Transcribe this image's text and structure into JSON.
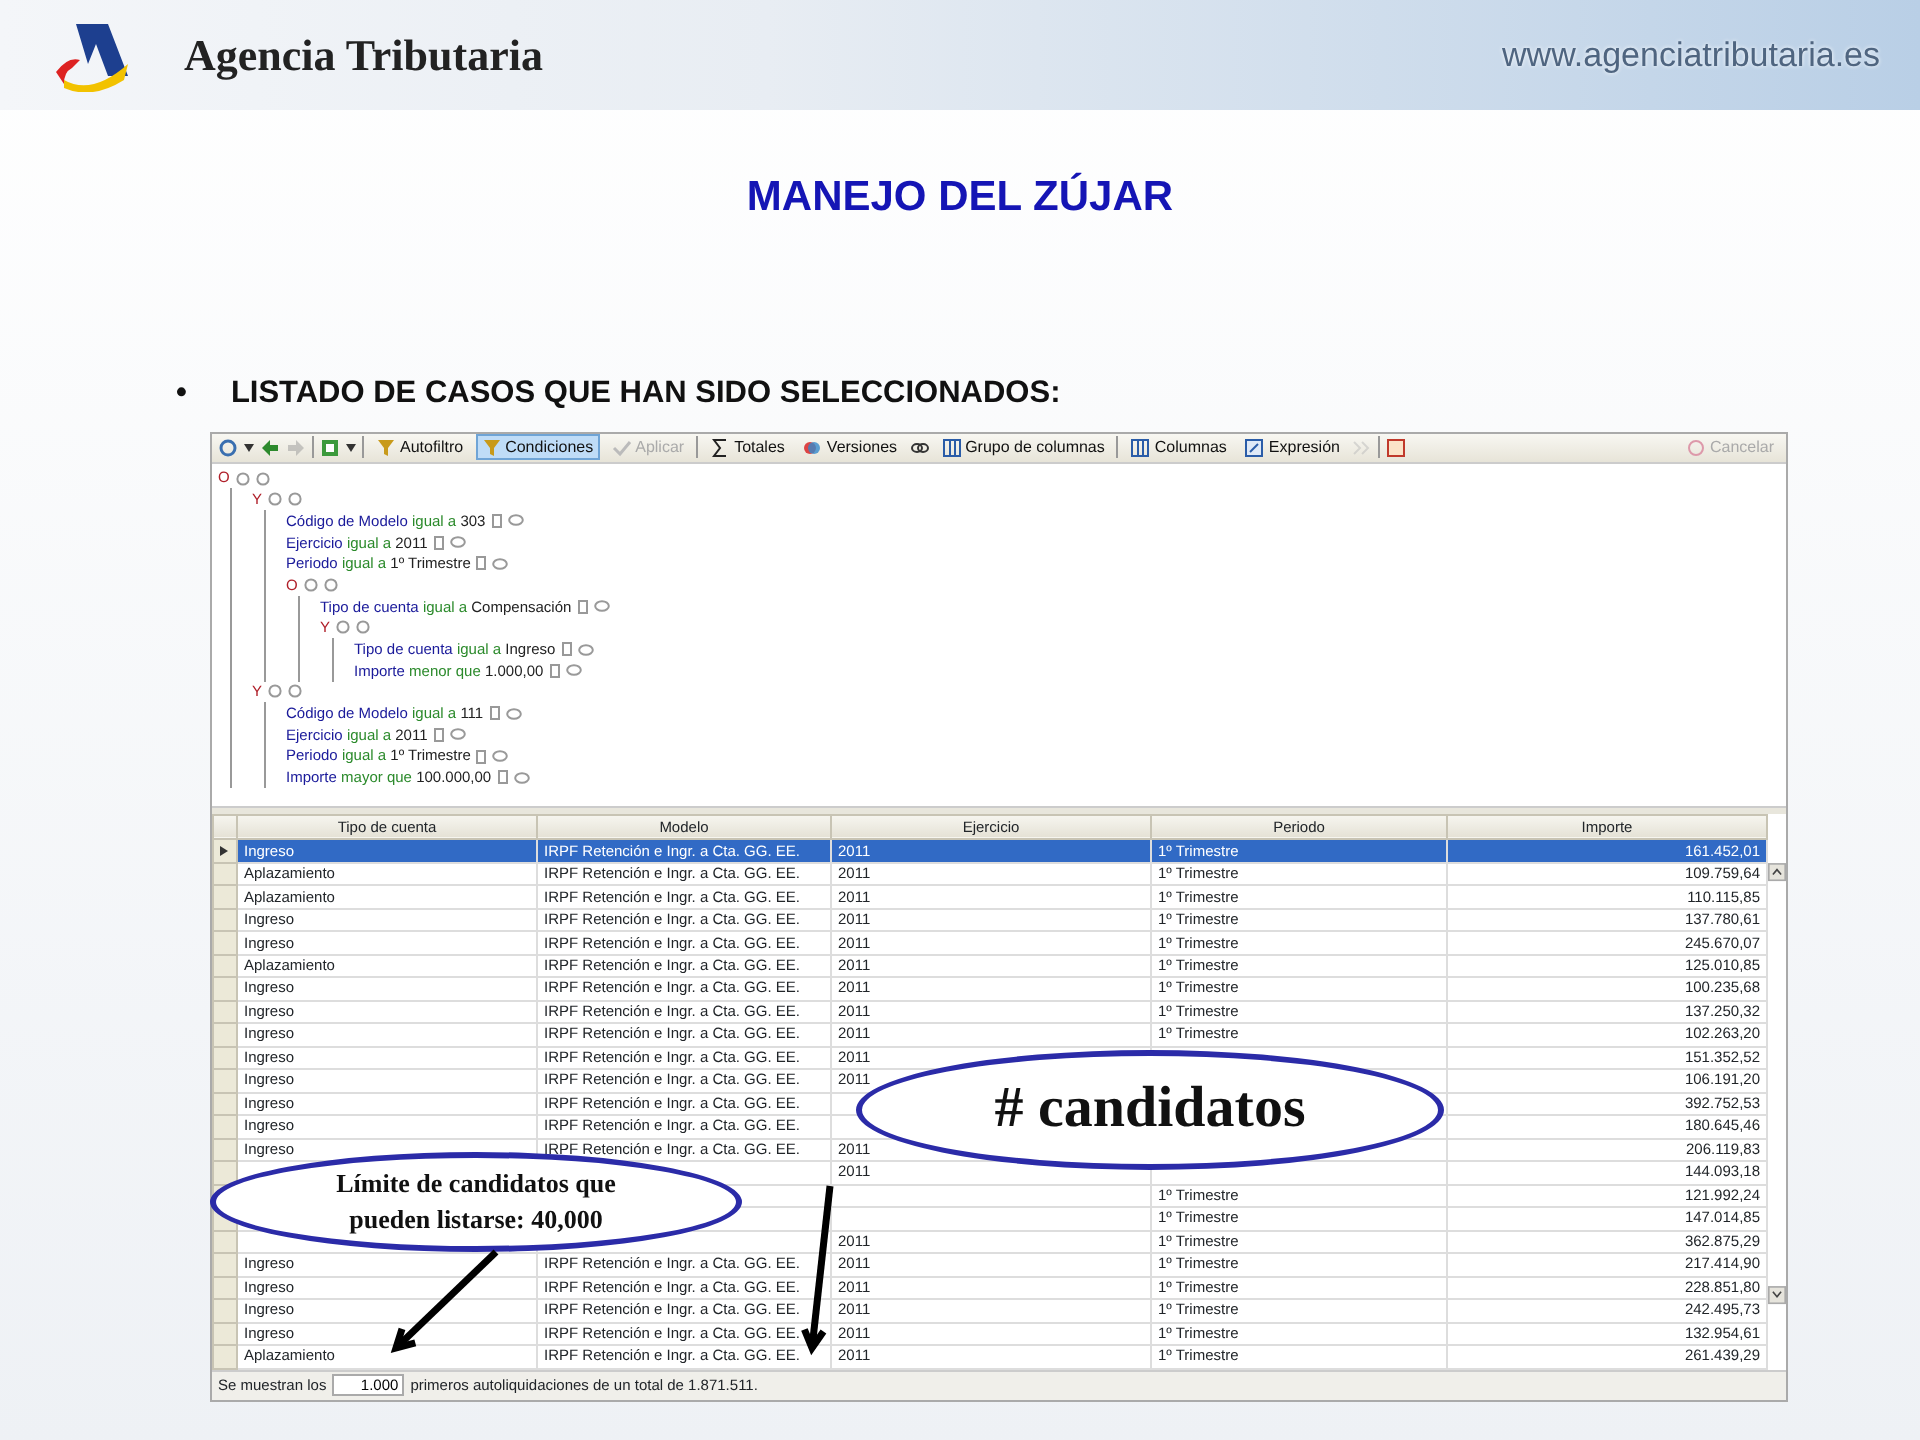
{
  "header": {
    "brand": "Agencia Tributaria",
    "website": "www.agenciatributaria.es"
  },
  "title": "MANEJO DEL ZÚJAR",
  "bullet": {
    "mark": "•",
    "text": "LISTADO DE CASOS QUE HAN SIDO SELECCIONADOS:"
  },
  "toolbar": [
    {
      "kind": "icon",
      "disabled": false
    },
    {
      "kind": "caret",
      "disabled": false
    },
    {
      "kind": "icon",
      "disabled": false
    },
    {
      "kind": "icon",
      "disabled": true
    },
    {
      "kind": "sep"
    },
    {
      "kind": "icon",
      "disabled": false
    },
    {
      "kind": "caret",
      "disabled": false
    },
    {
      "kind": "sep"
    },
    {
      "kind": "button",
      "label": "Autofiltro",
      "selected": false,
      "disabled": false
    },
    {
      "kind": "button",
      "label": "Condiciones",
      "selected": true,
      "disabled": false
    },
    {
      "kind": "button",
      "label": "Aplicar",
      "selected": false,
      "disabled": true
    },
    {
      "kind": "sep"
    },
    {
      "kind": "button",
      "label": "Totales",
      "selected": false,
      "disabled": false
    },
    {
      "kind": "button",
      "label": "Versiones",
      "selected": false,
      "disabled": false
    },
    {
      "kind": "icon",
      "disabled": false
    },
    {
      "kind": "button",
      "label": "Grupo de columnas",
      "selected": false,
      "disabled": false
    },
    {
      "kind": "sep"
    },
    {
      "kind": "button",
      "label": "Columnas",
      "selected": false,
      "disabled": false
    },
    {
      "kind": "button",
      "label": "Expresión",
      "selected": false,
      "disabled": false
    },
    {
      "kind": "icon",
      "disabled": true
    },
    {
      "kind": "sep"
    },
    {
      "kind": "icon",
      "disabled": false
    },
    {
      "kind": "spacer"
    },
    {
      "kind": "button",
      "label": "Cancelar",
      "selected": false,
      "disabled": true
    }
  ],
  "tree": {
    "kind": "group",
    "operator": "O",
    "children": [
      {
        "kind": "group",
        "operator": "Y",
        "children": [
          {
            "kind": "condition",
            "field": "Código de Modelo",
            "op": "igual a",
            "value": "303"
          },
          {
            "kind": "condition",
            "field": "Ejercicio",
            "op": "igual a",
            "value": "2011"
          },
          {
            "kind": "condition",
            "field": "Periodo",
            "op": "igual a",
            "value": "1º Trimestre"
          },
          {
            "kind": "group",
            "operator": "O",
            "children": [
              {
                "kind": "condition",
                "field": "Tipo de cuenta",
                "op": "igual a",
                "value": "Compensación"
              },
              {
                "kind": "group",
                "operator": "Y",
                "children": [
                  {
                    "kind": "condition",
                    "field": "Tipo de cuenta",
                    "op": "igual a",
                    "value": "Ingreso"
                  },
                  {
                    "kind": "condition",
                    "field": "Importe",
                    "op": "menor que",
                    "value": "1.000,00"
                  }
                ]
              }
            ]
          }
        ]
      },
      {
        "kind": "group",
        "operator": "Y",
        "children": [
          {
            "kind": "condition",
            "field": "Código de Modelo",
            "op": "igual a",
            "value": "111"
          },
          {
            "kind": "condition",
            "field": "Ejercicio",
            "op": "igual a",
            "value": "2011"
          },
          {
            "kind": "condition",
            "field": "Periodo",
            "op": "igual a",
            "value": "1º Trimestre"
          },
          {
            "kind": "condition",
            "field": "Importe",
            "op": "mayor que",
            "value": "100.000,00"
          }
        ]
      }
    ]
  },
  "table": {
    "columns": [
      "Tipo de cuenta",
      "Modelo",
      "Ejercicio",
      "Periodo",
      "Importe"
    ],
    "rows": [
      {
        "selected": true,
        "cells": [
          "Ingreso",
          "IRPF Retención e Ingr. a Cta. GG. EE.",
          "2011",
          "1º Trimestre",
          "161.452,01"
        ]
      },
      {
        "selected": false,
        "cells": [
          "Aplazamiento",
          "IRPF Retención e Ingr. a Cta. GG. EE.",
          "2011",
          "1º Trimestre",
          "109.759,64"
        ]
      },
      {
        "selected": false,
        "cells": [
          "Aplazamiento",
          "IRPF Retención e Ingr. a Cta. GG. EE.",
          "2011",
          "1º Trimestre",
          "110.115,85"
        ]
      },
      {
        "selected": false,
        "cells": [
          "Ingreso",
          "IRPF Retención e Ingr. a Cta. GG. EE.",
          "2011",
          "1º Trimestre",
          "137.780,61"
        ]
      },
      {
        "selected": false,
        "cells": [
          "Ingreso",
          "IRPF Retención e Ingr. a Cta. GG. EE.",
          "2011",
          "1º Trimestre",
          "245.670,07"
        ]
      },
      {
        "selected": false,
        "cells": [
          "Aplazamiento",
          "IRPF Retención e Ingr. a Cta. GG. EE.",
          "2011",
          "1º Trimestre",
          "125.010,85"
        ]
      },
      {
        "selected": false,
        "cells": [
          "Ingreso",
          "IRPF Retención e Ingr. a Cta. GG. EE.",
          "2011",
          "1º Trimestre",
          "100.235,68"
        ]
      },
      {
        "selected": false,
        "cells": [
          "Ingreso",
          "IRPF Retención e Ingr. a Cta. GG. EE.",
          "2011",
          "1º Trimestre",
          "137.250,32"
        ]
      },
      {
        "selected": false,
        "cells": [
          "Ingreso",
          "IRPF Retención e Ingr. a Cta. GG. EE.",
          "2011",
          "1º Trimestre",
          "102.263,20"
        ]
      },
      {
        "selected": false,
        "cells": [
          "Ingreso",
          "IRPF Retención e Ingr. a Cta. GG. EE.",
          "2011",
          null,
          "151.352,52"
        ]
      },
      {
        "selected": false,
        "cells": [
          "Ingreso",
          "IRPF Retención e Ingr. a Cta. GG. EE.",
          "2011",
          null,
          "106.191,20"
        ]
      },
      {
        "selected": false,
        "cells": [
          "Ingreso",
          "IRPF Retención e Ingr. a Cta. GG. EE.",
          null,
          null,
          "392.752,53"
        ]
      },
      {
        "selected": false,
        "cells": [
          "Ingreso",
          "IRPF Retención e Ingr. a Cta. GG. EE.",
          null,
          null,
          "180.645,46"
        ]
      },
      {
        "selected": false,
        "cells": [
          "Ingreso",
          "IRPF Retención e Ingr. a Cta. GG. EE.",
          "2011",
          null,
          "206.119,83"
        ]
      },
      {
        "selected": false,
        "cells": [
          null,
          null,
          "2011",
          null,
          "144.093,18"
        ]
      },
      {
        "selected": false,
        "cells": [
          null,
          null,
          null,
          "1º Trimestre",
          "121.992,24"
        ]
      },
      {
        "selected": false,
        "cells": [
          null,
          null,
          null,
          "1º Trimestre",
          "147.014,85"
        ]
      },
      {
        "selected": false,
        "cells": [
          null,
          null,
          "2011",
          "1º Trimestre",
          "362.875,29"
        ]
      },
      {
        "selected": false,
        "cells": [
          "Ingreso",
          "IRPF Retención e Ingr. a Cta. GG. EE.",
          "2011",
          "1º Trimestre",
          "217.414,90"
        ]
      },
      {
        "selected": false,
        "cells": [
          "Ingreso",
          "IRPF Retención e Ingr. a Cta. GG. EE.",
          "2011",
          "1º Trimestre",
          "228.851,80"
        ]
      },
      {
        "selected": false,
        "cells": [
          "Ingreso",
          "IRPF Retención e Ingr. a Cta. GG. EE.",
          "2011",
          "1º Trimestre",
          "242.495,73"
        ]
      },
      {
        "selected": false,
        "cells": [
          "Ingreso",
          "IRPF Retención e Ingr. a Cta. GG. EE.",
          "2011",
          "1º Trimestre",
          "132.954,61"
        ]
      },
      {
        "selected": false,
        "cells": [
          "Aplazamiento",
          "IRPF Retención e Ingr. a Cta. GG. EE.",
          "2011",
          "1º Trimestre",
          "261.439,29"
        ]
      }
    ]
  },
  "status_bar": {
    "prefix": "Se muestran los",
    "count": "1.000",
    "suffix": "primeros autoliquidaciones de un total de 1.871.511."
  },
  "callouts": [
    {
      "text": "Límite de candidatos  que pueden listarse: 40,000",
      "kind": "small"
    },
    {
      "text": "# candidatos",
      "kind": "large"
    }
  ]
}
